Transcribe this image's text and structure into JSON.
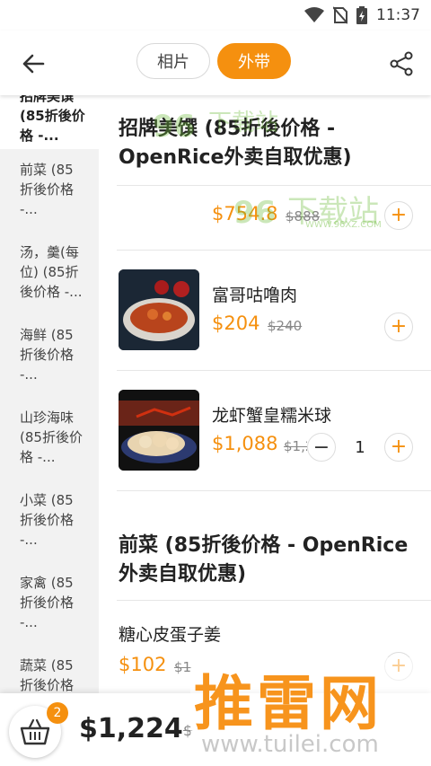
{
  "status": {
    "time": "11:37"
  },
  "tabs": [
    {
      "label": "相片"
    },
    {
      "label": "外带"
    }
  ],
  "sidebar": {
    "items": [
      {
        "label": "招牌美馔 (85折後价格 -..."
      },
      {
        "label": "前菜 (85折後价格 -..."
      },
      {
        "label": "汤，羹(每位) (85折後价格 -..."
      },
      {
        "label": "海鲜 (85折後价格 -..."
      },
      {
        "label": "山珍海味 (85折後价格 -..."
      },
      {
        "label": "小菜 (85折後价格 -..."
      },
      {
        "label": "家禽 (85折後价格 -..."
      },
      {
        "label": "蔬菜 (85折後价格 -..."
      }
    ]
  },
  "main": {
    "section1_title": "招牌美馔 (85折後价格 - OpenRice外卖自取优惠)",
    "dishes": [
      {
        "name": "",
        "price": "$754.8",
        "orig": "$888"
      },
      {
        "name": "富哥咕噜肉",
        "price": "$204",
        "orig": "$240"
      },
      {
        "name": "龙虾蟹皇糯米球",
        "price": "$1,088",
        "orig": "$1,28",
        "qty": "1"
      }
    ],
    "section2_title": "前菜 (85折後价格 - OpenRice外卖自取优惠)",
    "dish4": {
      "name": "糖心皮蛋子姜",
      "price": "$102",
      "orig": "$1"
    }
  },
  "cart": {
    "count": "2",
    "total": "$1,224",
    "orig": "$"
  },
  "watermarks": {
    "top": "下载站",
    "top_url": "WWW.96XZ.COM",
    "bottom": "推雷网",
    "bottom_url": "www.tuilei.com"
  },
  "colors": {
    "accent": "#f5900f"
  }
}
